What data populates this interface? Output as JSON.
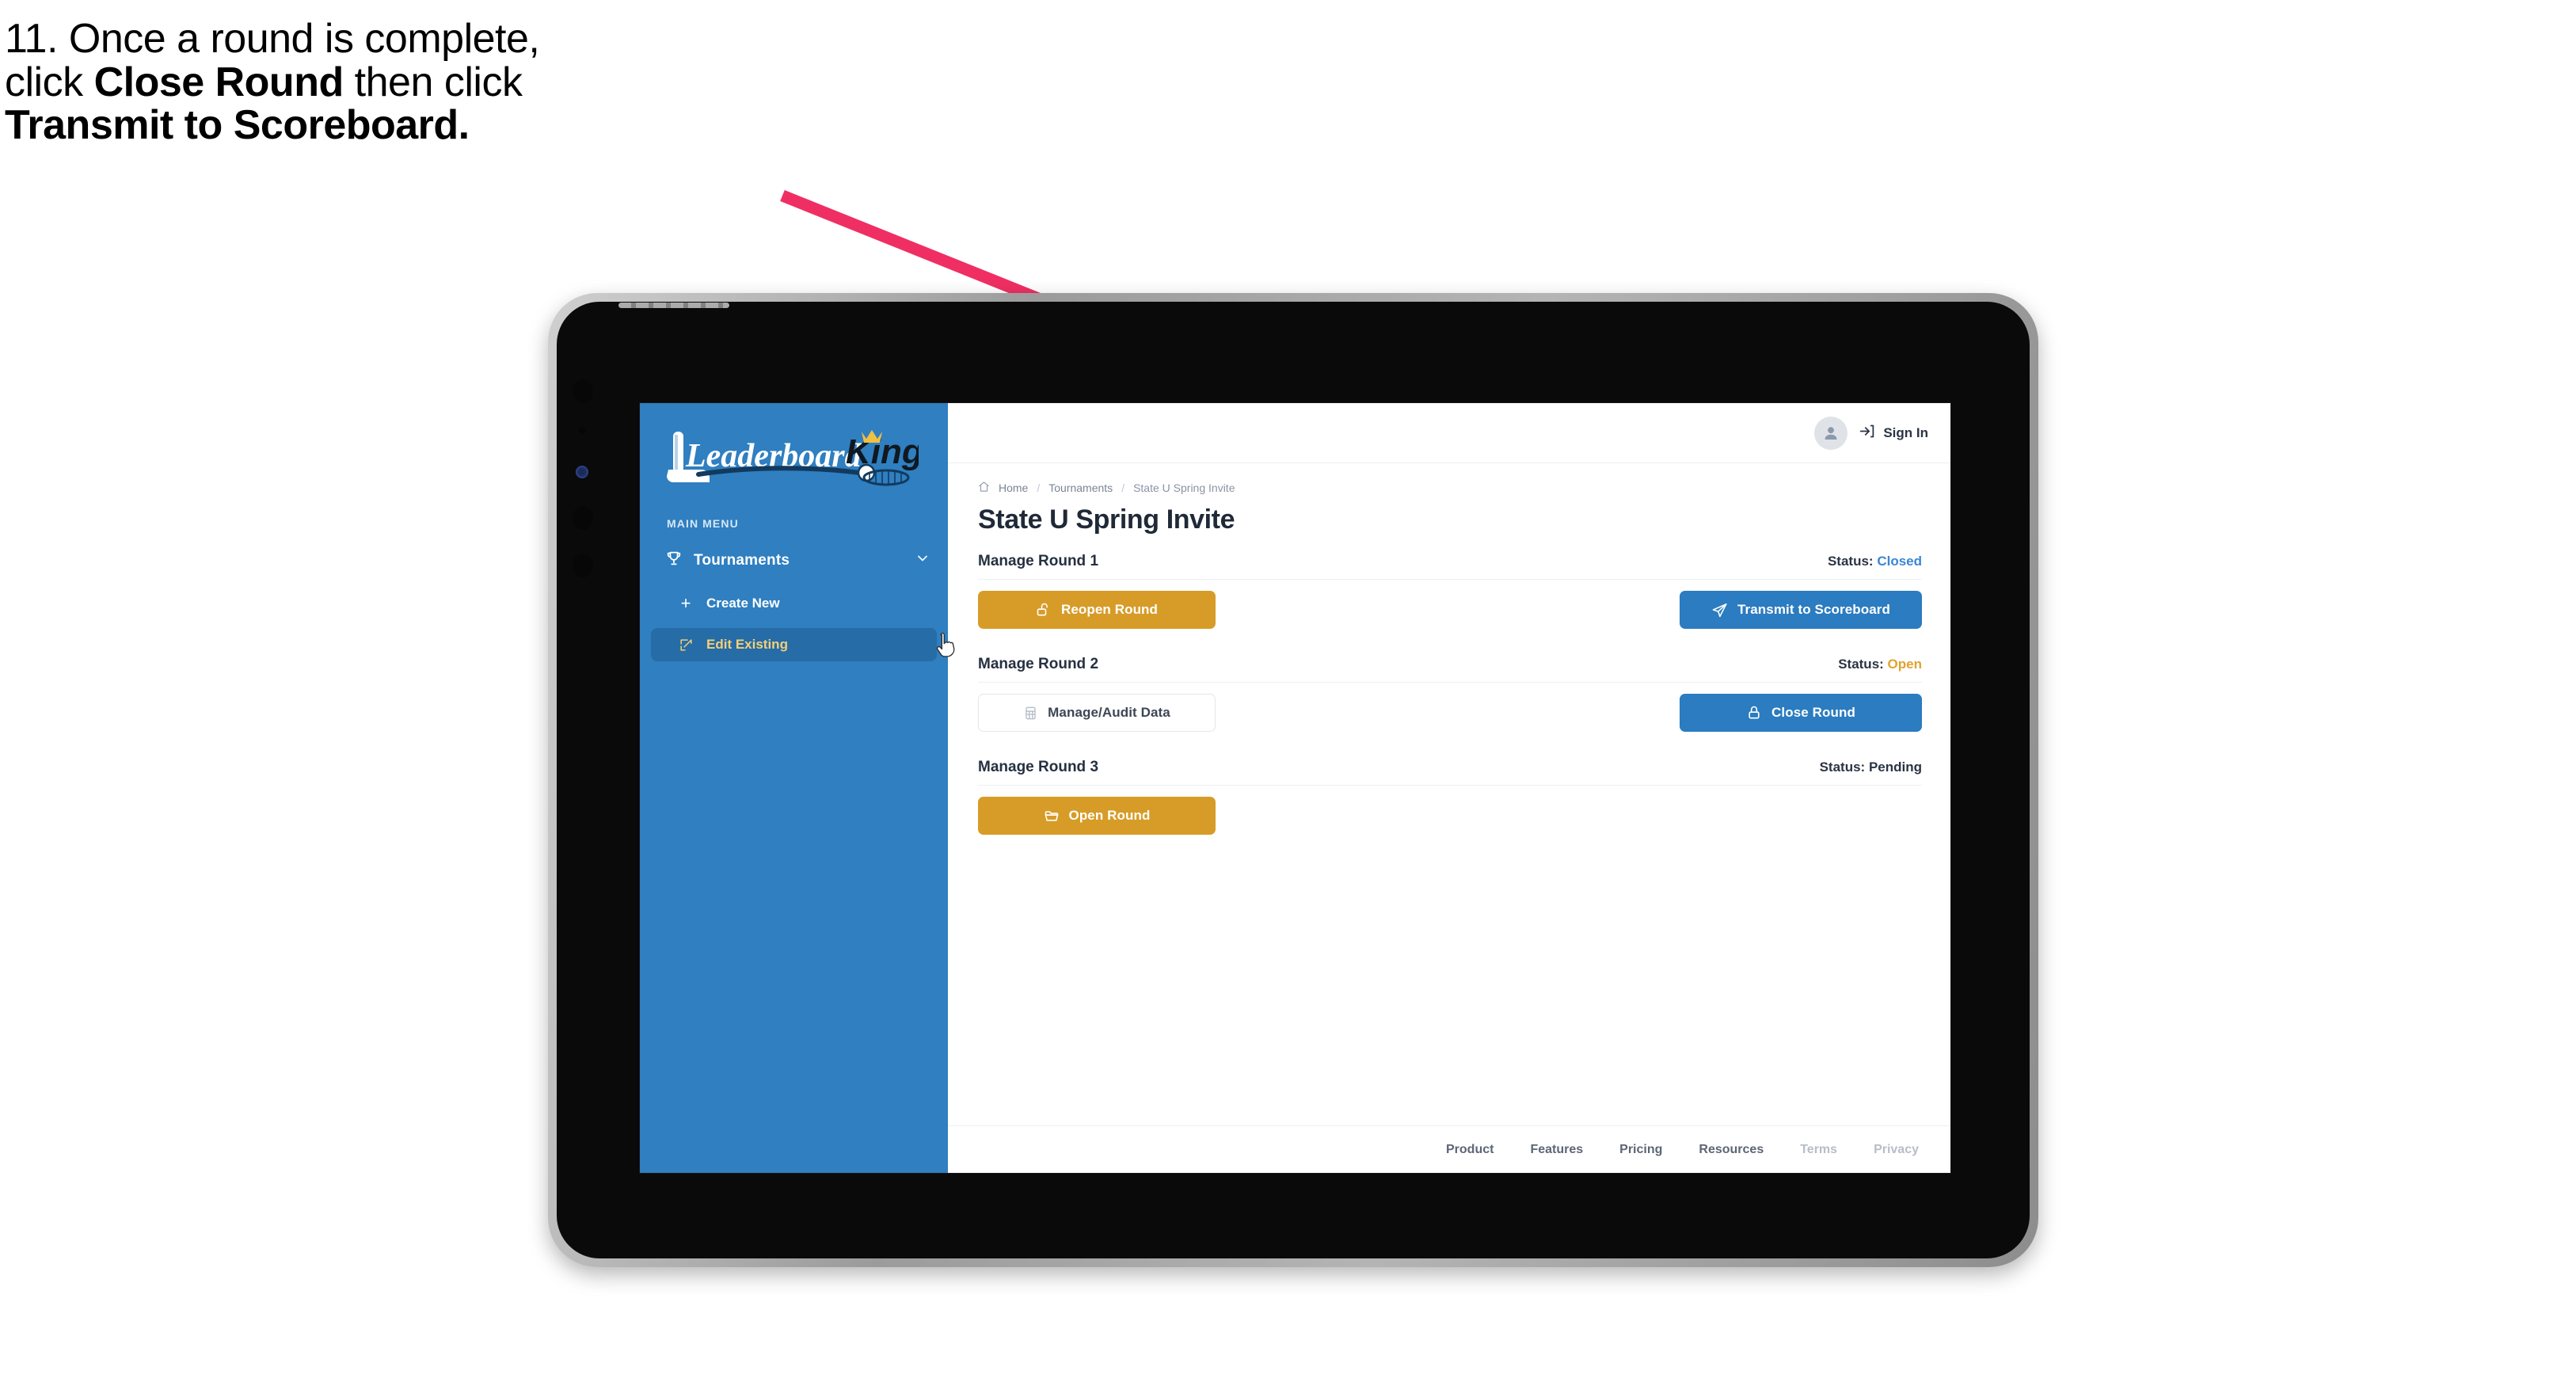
{
  "annotation": {
    "step_number": "11.",
    "lines": [
      {
        "parts": [
          {
            "t": "11. Once a round is complete,",
            "b": false
          }
        ]
      },
      {
        "parts": [
          {
            "t": "click ",
            "b": false
          },
          {
            "t": "Close Round",
            "b": true
          },
          {
            "t": " then click",
            "b": false
          }
        ]
      },
      {
        "parts": [
          {
            "t": "Transmit to Scoreboard.",
            "b": true
          }
        ]
      }
    ],
    "full_text": "11. Once a round is complete, click Close Round then click Transmit to Scoreboard.",
    "arrow_color": "#ef2f63"
  },
  "app": {
    "brand": {
      "name": "LeaderboardKing",
      "word_one": "Leaderboard",
      "word_two": "King",
      "icon": "crown-icon"
    },
    "sidebar": {
      "section_label": "MAIN MENU",
      "background": "#2f7fc1",
      "nav": [
        {
          "label": "Tournaments",
          "icon": "trophy-icon",
          "expander": "chevron-down-icon",
          "children": [
            {
              "label": "Create New",
              "icon": "plus-icon",
              "active": false
            },
            {
              "label": "Edit Existing",
              "icon": "edit-square-icon",
              "active": true
            }
          ]
        }
      ],
      "active_item_color": "#f2cf7a"
    },
    "topbar": {
      "avatar_icon": "user-avatar-icon",
      "signin_icon": "login-arrow-icon",
      "signin_label": "Sign In"
    },
    "breadcrumb": [
      {
        "label": "Home",
        "icon": "home-icon"
      },
      {
        "label": "Tournaments",
        "icon": ""
      },
      {
        "label": "State U Spring Invite",
        "icon": ""
      }
    ],
    "breadcrumb_separator": "/",
    "page_title": "State U Spring Invite",
    "status_prefix": "Status:",
    "rounds": [
      {
        "title": "Manage Round 1",
        "status": "Closed",
        "status_class": "st-closed",
        "left_button": {
          "label": "Reopen Round",
          "icon": "unlock-icon",
          "style": "gold"
        },
        "right_button": {
          "label": "Transmit to Scoreboard",
          "icon": "send-plane-icon",
          "style": "blue"
        }
      },
      {
        "title": "Manage Round 2",
        "status": "Open",
        "status_class": "st-open",
        "left_button": {
          "label": "Manage/Audit Data",
          "icon": "spreadsheet-icon",
          "style": "ghost"
        },
        "right_button": {
          "label": "Close Round",
          "icon": "lock-icon",
          "style": "blue"
        }
      },
      {
        "title": "Manage Round 3",
        "status": "Pending",
        "status_class": "st-pending",
        "left_button": {
          "label": "Open Round",
          "icon": "folder-open-icon",
          "style": "gold"
        },
        "right_button": null
      }
    ],
    "footer_links": [
      {
        "label": "Product",
        "dim": false
      },
      {
        "label": "Features",
        "dim": false
      },
      {
        "label": "Pricing",
        "dim": false
      },
      {
        "label": "Resources",
        "dim": false
      },
      {
        "label": "Terms",
        "dim": true
      },
      {
        "label": "Privacy",
        "dim": true
      }
    ],
    "colors": {
      "sidebar_blue": "#2f7fc1",
      "sidebar_active": "#266ca6",
      "gold": "#d79c28",
      "blue": "#2b7cc0",
      "status_closed": "#3a86d4",
      "status_open": "#e0a32e",
      "accent_gold_text": "#f2cf7a"
    },
    "cursor": {
      "icon": "pointing-hand-cursor"
    }
  },
  "device": {
    "type": "tablet",
    "frame_color": "#9b9b9b",
    "bezel_color": "#0a0a0a"
  }
}
